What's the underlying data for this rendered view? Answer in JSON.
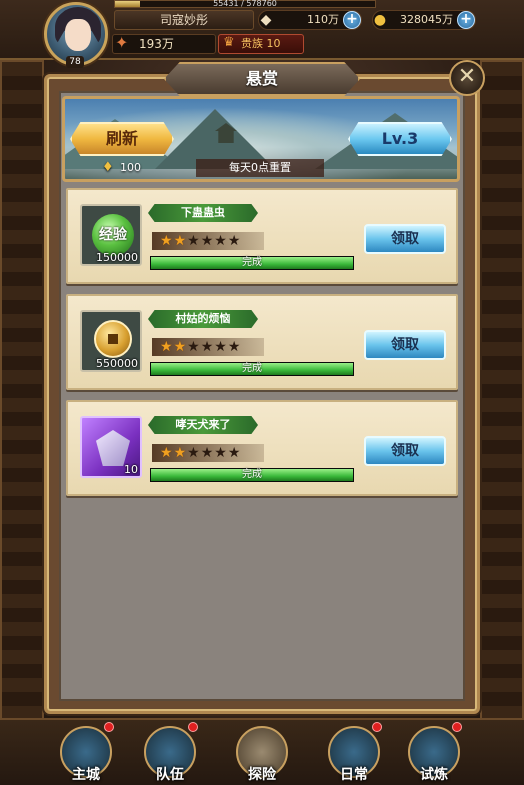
{
  "player": {
    "name": "司寇妙彤",
    "level": "78",
    "exp_text": "55431 / 578760",
    "exp_fraction": 0.096,
    "power": "193万",
    "noble_label": "贵族 10"
  },
  "resources": {
    "silver": "110万",
    "coins": "328045万"
  },
  "modal": {
    "title": "悬赏",
    "close_label": "✕",
    "refresh_label": "刷新",
    "refresh_cost": "100",
    "reset_note": "每天0点重置",
    "level_label": "Lv.3"
  },
  "quests": [
    {
      "title": "下蛊蛊虫",
      "reward_type": "exp-orb",
      "reward_icon_text": "经验",
      "reward_count": "150000",
      "stars_filled": 2,
      "stars_total": 6,
      "progress_fraction": 1.0,
      "progress_label": "完成",
      "claim_label": "领取"
    },
    {
      "title": "村姑的烦恼",
      "reward_type": "coin",
      "reward_icon_text": "",
      "reward_count": "550000",
      "stars_filled": 2,
      "stars_total": 6,
      "progress_fraction": 1.0,
      "progress_label": "完成",
      "claim_label": "领取"
    },
    {
      "title": "哮天犬来了",
      "reward_type": "purple-gem",
      "reward_icon_text": "",
      "reward_count": "10",
      "stars_filled": 2,
      "stars_total": 6,
      "progress_fraction": 1.0,
      "progress_label": "完成",
      "claim_label": "领取"
    }
  ],
  "nav": [
    {
      "label": "主城",
      "icon": "city-icon",
      "badge": true
    },
    {
      "label": "队伍",
      "icon": "team-icon",
      "badge": true
    },
    {
      "label": "探险",
      "icon": "adventure-icon",
      "badge": false
    },
    {
      "label": "日常",
      "icon": "daily-icon",
      "badge": true
    },
    {
      "label": "试炼",
      "icon": "trial-icon",
      "badge": true
    }
  ],
  "colors": {
    "accent_gold": "#c8a060",
    "button_blue": "#6ac4ec",
    "button_orange": "#f0b840",
    "progress_green": "#3ab83a",
    "star_on": "#f0a020"
  }
}
